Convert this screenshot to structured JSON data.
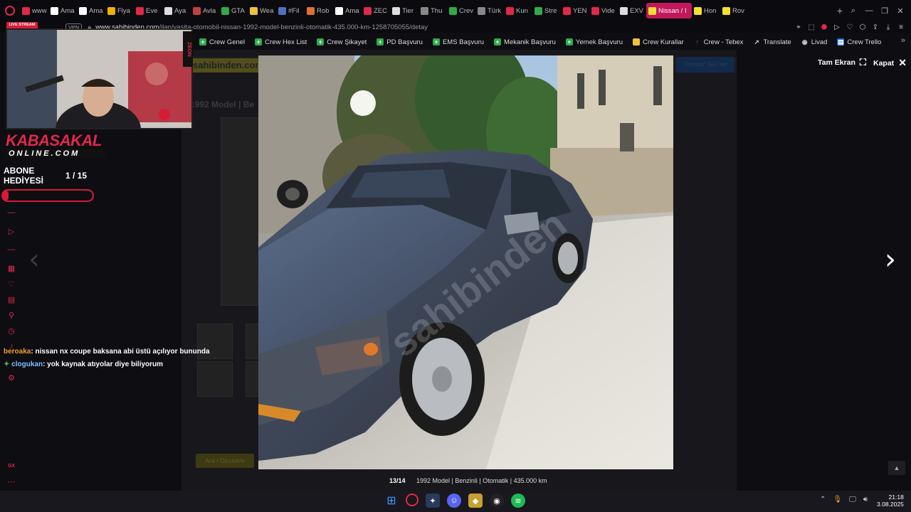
{
  "browser": {
    "tabs": [
      {
        "label": "www",
        "fav": "#e0284a"
      },
      {
        "label": "Ama",
        "fav": "#ffffff"
      },
      {
        "label": "Ama",
        "fav": "#ffffff"
      },
      {
        "label": "Flya",
        "fav": "#f0b000"
      },
      {
        "label": "Eve",
        "fav": "#e0284a"
      },
      {
        "label": "Aya",
        "fav": "#dddddd"
      },
      {
        "label": "Avla",
        "fav": "#c04040"
      },
      {
        "label": "GTA",
        "fav": "#2eaa4a"
      },
      {
        "label": "Wea",
        "fav": "#f0c040"
      },
      {
        "label": "#Fil",
        "fav": "#5070c0"
      },
      {
        "label": "Rob",
        "fav": "#e07030"
      },
      {
        "label": "Ama",
        "fav": "#ffffff"
      },
      {
        "label": "ZEC",
        "fav": "#e0284a"
      },
      {
        "label": "Tier",
        "fav": "#dddddd"
      },
      {
        "label": "Thu",
        "fav": "#888888"
      },
      {
        "label": "Crev",
        "fav": "#2eaa4a"
      },
      {
        "label": "Türk",
        "fav": "#888888"
      },
      {
        "label": "Kun",
        "fav": "#e0284a"
      },
      {
        "label": "Stre",
        "fav": "#2eaa4a"
      },
      {
        "label": "YEN",
        "fav": "#e0284a"
      },
      {
        "label": "Vide",
        "fav": "#e0284a"
      },
      {
        "label": "EXV",
        "fav": "#dddddd"
      },
      {
        "label": "Nissan / I",
        "fav": "#f5e030",
        "active": true
      },
      {
        "label": "Hon",
        "fav": "#f5e030"
      },
      {
        "label": "Rov",
        "fav": "#f5e030"
      }
    ],
    "vpn": "VPN",
    "url_domain": "www.sahibinden.com",
    "url_path": "/ilan/vasita-otomobil-nissan-1992-model-benzinli-otomatik-435.000-km-1258705055/detay",
    "bookmarks": [
      "Crew Genel",
      "Crew Hex List",
      "Crew Şikayet",
      "PD Başvuru",
      "EMS Başvuru",
      "Mekanik Başvuru",
      "Yemek Başvuru",
      "Crew Kurallar",
      "Crew - Tebex",
      "Translate",
      "Livad",
      "Crew Trello"
    ]
  },
  "viewer": {
    "fullscreen_label": "Tam Ekran",
    "close_label": "Kapat",
    "counter": "13/14",
    "caption": "1992 Model | Benzinli | Otomatik | 435.000 km",
    "watermark": "sahibinden"
  },
  "background_page": {
    "logo": "sahibinden.com",
    "title": "1992 Model | Be",
    "publish_button": "Ücretsiz* İlan Ver",
    "fav_button": "Ara / Destekle"
  },
  "stream": {
    "live_badge": "LIVE STREAM",
    "zeon": "ZEON",
    "brand_line1": "KABASAKAL",
    "brand_line2": "ONLINE.COM",
    "gift_label": "ABONE HEDİYESİ",
    "gift_count": "1 / 15",
    "gift_progress": 0.067,
    "chat": [
      {
        "user": "beroaka",
        "message": ": nissan nx coupe baksana abi üstü açılıyor bununda"
      },
      {
        "user": "clogukan",
        "message": ": yok kaynak atıyolar diye biliyorum"
      }
    ]
  },
  "taskbar": {
    "time": "21:18",
    "date": "3.08.2025",
    "apps": [
      "windows-start",
      "opera-gx",
      "app-2",
      "discord",
      "app-4",
      "obs",
      "spotify"
    ]
  }
}
